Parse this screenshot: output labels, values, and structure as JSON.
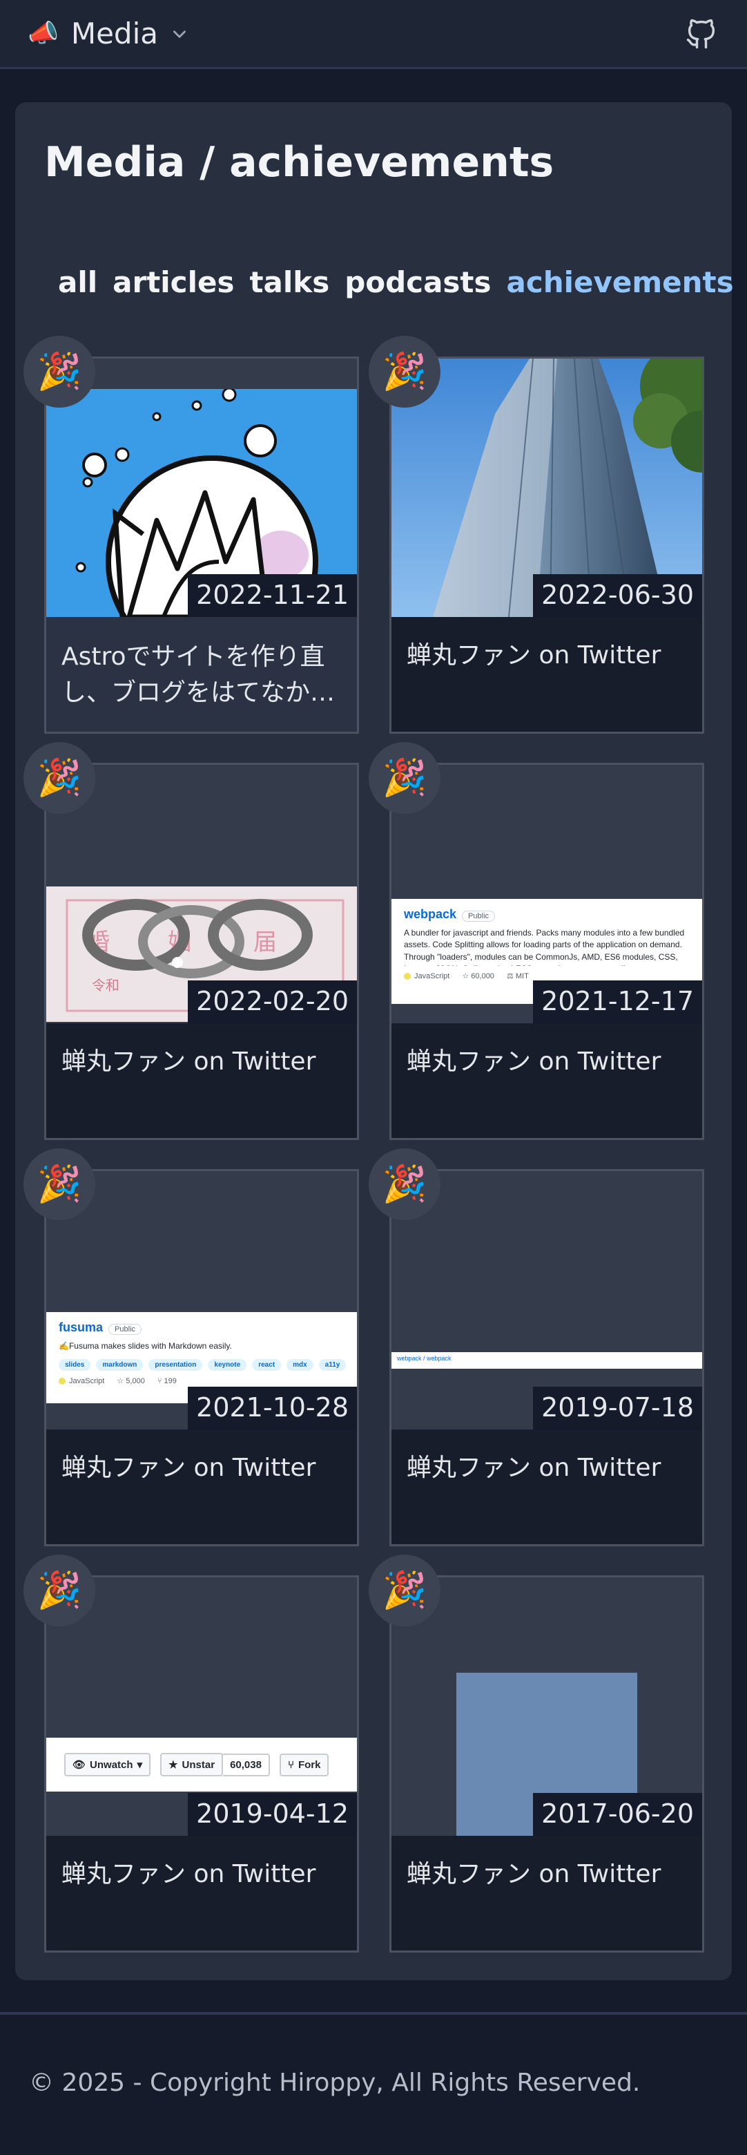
{
  "header": {
    "emoji": "📣",
    "title": "Media"
  },
  "page": {
    "title": "Media / achievements",
    "tabs": [
      {
        "label": "all",
        "active": false
      },
      {
        "label": "articles",
        "active": false
      },
      {
        "label": "talks",
        "active": false
      },
      {
        "label": "podcasts",
        "active": false
      },
      {
        "label": "achievements",
        "active": true
      }
    ]
  },
  "cards": [
    {
      "date": "2022-11-21",
      "caption": "Astroでサイトを作り直し、ブログをはてなか…",
      "badge": "🎉"
    },
    {
      "date": "2022-06-30",
      "caption": "蝉丸ファン on Twitter",
      "badge": "🎉"
    },
    {
      "date": "2022-02-20",
      "caption": "蝉丸ファン on Twitter",
      "badge": "🎉",
      "photo_text": [
        "婚",
        "姻",
        "届",
        "令和"
      ]
    },
    {
      "date": "2021-12-17",
      "caption": "蝉丸ファン on Twitter",
      "badge": "🎉",
      "repo": {
        "name": "webpack",
        "visibility": "Public",
        "description": "A bundler for javascript and friends. Packs many modules into a few bundled assets. Code Splitting allows for loading parts of the application on demand. Through \"loaders\", modules can be CommonJs, AMD, ES6 modules, CSS, Images, JSON, Coffeescript, LESS, ... and your custom stuff.",
        "language": "JavaScript",
        "stars": "60,000",
        "license": "MIT"
      }
    },
    {
      "date": "2021-10-28",
      "caption": "蝉丸ファン on Twitter",
      "badge": "🎉",
      "repo": {
        "name": "fusuma",
        "visibility": "Public",
        "description": "✍️Fusuma makes slides with Markdown easily.",
        "topics": [
          "slides",
          "markdown",
          "presentation",
          "keynote",
          "react",
          "mdx",
          "a11y"
        ],
        "language": "JavaScript",
        "stars": "5,000",
        "forks": "199"
      }
    },
    {
      "date": "2019-07-18",
      "caption": "蝉丸ファン on Twitter",
      "badge": "🎉",
      "repo": {
        "name": "webpack / webpack"
      }
    },
    {
      "date": "2019-04-12",
      "caption": "蝉丸ファン on Twitter",
      "badge": "🎉",
      "buttons": {
        "watch": "Unwatch",
        "star": "Unstar",
        "count": "60,038",
        "fork": "Fork"
      }
    },
    {
      "date": "2017-06-20",
      "caption": "蝉丸ファン on Twitter",
      "badge": "🎉"
    }
  ],
  "footer": {
    "text": "© 2025 - Copyright Hiroppy, All Rights Reserved."
  },
  "colors": {
    "background": "#151b2a",
    "panel": "#283040",
    "card": "#343c4c",
    "accent": "#93c5fd"
  },
  "icons": {
    "chevron": "chevron-down-icon",
    "github": "github-icon"
  }
}
